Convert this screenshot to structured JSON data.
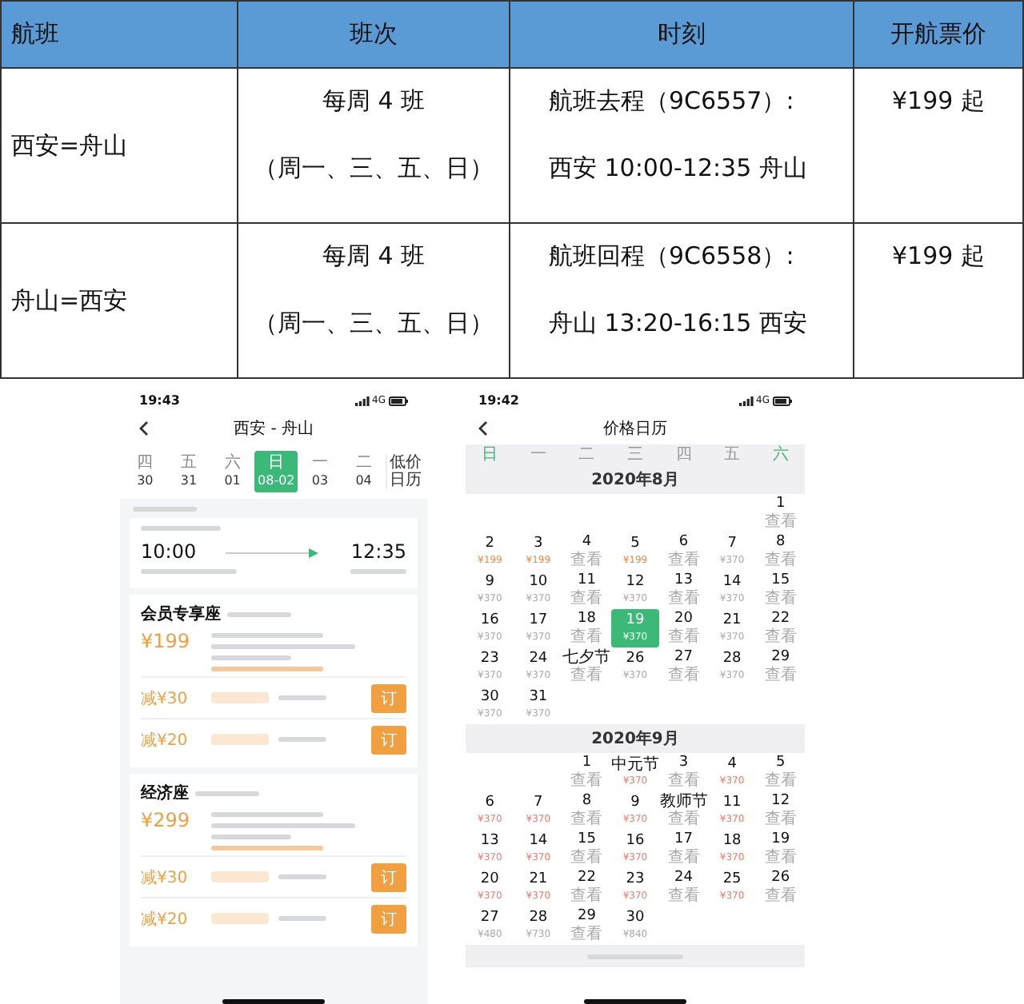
{
  "table": {
    "columns": [
      "航班",
      "班次",
      "时刻",
      "开航票价"
    ],
    "rows": [
      {
        "route": "西安=舟山",
        "frequency": [
          "每周 4 班",
          "（周一、三、五、日）"
        ],
        "schedule": [
          "航班去程（9C6557）:",
          "西安 10:00-12:35 舟山"
        ],
        "price": "¥199 起"
      },
      {
        "route": "舟山=西安",
        "frequency": [
          "每周 4 班",
          "（周一、三、五、日）"
        ],
        "schedule": [
          "航班回程（9C6558）:",
          "舟山 13:20-16:15 西安"
        ],
        "price": "¥199 起"
      }
    ]
  },
  "phone_booking": {
    "status": {
      "time": "19:43",
      "network": "4G"
    },
    "title": "西安 - 舟山",
    "dates": [
      {
        "weekday": "四",
        "date": "30",
        "selected": false
      },
      {
        "weekday": "五",
        "date": "31",
        "selected": false
      },
      {
        "weekday": "六",
        "date": "01",
        "selected": false
      },
      {
        "weekday": "日",
        "date": "08-02",
        "selected": true
      },
      {
        "weekday": "一",
        "date": "03",
        "selected": false
      },
      {
        "weekday": "二",
        "date": "04",
        "selected": false
      }
    ],
    "calendar_button": "低价日历",
    "flight": {
      "depart": "10:00",
      "arrive": "12:35"
    },
    "cabins": [
      {
        "name": "会员专享座",
        "price": "¥199",
        "offers": [
          {
            "discount": "减¥30",
            "button": "订"
          },
          {
            "discount": "减¥20",
            "button": "订"
          }
        ]
      },
      {
        "name": "经济座",
        "price": "¥299",
        "offers": [
          {
            "discount": "减¥30",
            "button": "订"
          },
          {
            "discount": "减¥20",
            "button": "订"
          }
        ]
      }
    ]
  },
  "phone_calendar": {
    "status": {
      "time": "19:42",
      "network": "4G"
    },
    "title": "价格日历",
    "weekdays": [
      {
        "label": "日",
        "color": "#3cb878"
      },
      {
        "label": "一",
        "color": "#999999"
      },
      {
        "label": "二",
        "color": "#999999"
      },
      {
        "label": "三",
        "color": "#999999"
      },
      {
        "label": "四",
        "color": "#999999"
      },
      {
        "label": "五",
        "color": "#999999"
      },
      {
        "label": "六",
        "color": "#3cb878"
      }
    ],
    "months": [
      {
        "title": "2020年8月",
        "cells": [
          {
            "kind": "blank"
          },
          {
            "kind": "blank"
          },
          {
            "kind": "blank"
          },
          {
            "kind": "blank"
          },
          {
            "kind": "blank"
          },
          {
            "kind": "blank"
          },
          {
            "kind": "day",
            "day": "1",
            "sub": "查看",
            "color": "#aaaaaa",
            "selected": false
          },
          {
            "kind": "day",
            "day": "2",
            "sub": "¥199",
            "color": "#f08a3c",
            "selected": false
          },
          {
            "kind": "day",
            "day": "3",
            "sub": "¥199",
            "color": "#f08a3c",
            "selected": false
          },
          {
            "kind": "day",
            "day": "4",
            "sub": "查看",
            "color": "#aaaaaa",
            "selected": false
          },
          {
            "kind": "day",
            "day": "5",
            "sub": "¥199",
            "color": "#f08a3c",
            "selected": false
          },
          {
            "kind": "day",
            "day": "6",
            "sub": "查看",
            "color": "#aaaaaa",
            "selected": false
          },
          {
            "kind": "day",
            "day": "7",
            "sub": "¥370",
            "color": "#aaaaaa",
            "selected": false
          },
          {
            "kind": "day",
            "day": "8",
            "sub": "查看",
            "color": "#aaaaaa",
            "selected": false
          },
          {
            "kind": "day",
            "day": "9",
            "sub": "¥370",
            "color": "#aaaaaa",
            "selected": false
          },
          {
            "kind": "day",
            "day": "10",
            "sub": "¥370",
            "color": "#aaaaaa",
            "selected": false
          },
          {
            "kind": "day",
            "day": "11",
            "sub": "查看",
            "color": "#aaaaaa",
            "selected": false
          },
          {
            "kind": "day",
            "day": "12",
            "sub": "¥370",
            "color": "#aaaaaa",
            "selected": false
          },
          {
            "kind": "day",
            "day": "13",
            "sub": "查看",
            "color": "#aaaaaa",
            "selected": false
          },
          {
            "kind": "day",
            "day": "14",
            "sub": "¥370",
            "color": "#aaaaaa",
            "selected": false
          },
          {
            "kind": "day",
            "day": "15",
            "sub": "查看",
            "color": "#aaaaaa",
            "selected": false
          },
          {
            "kind": "day",
            "day": "16",
            "sub": "¥370",
            "color": "#aaaaaa",
            "selected": false
          },
          {
            "kind": "day",
            "day": "17",
            "sub": "¥370",
            "color": "#aaaaaa",
            "selected": false
          },
          {
            "kind": "day",
            "day": "18",
            "sub": "查看",
            "color": "#aaaaaa",
            "selected": false
          },
          {
            "kind": "day",
            "day": "19",
            "sub": "¥370",
            "color": "#ffffff",
            "selected": true
          },
          {
            "kind": "day",
            "day": "20",
            "sub": "查看",
            "color": "#aaaaaa",
            "selected": false
          },
          {
            "kind": "day",
            "day": "21",
            "sub": "¥370",
            "color": "#aaaaaa",
            "selected": false
          },
          {
            "kind": "day",
            "day": "22",
            "sub": "查看",
            "color": "#aaaaaa",
            "selected": false
          },
          {
            "kind": "day",
            "day": "23",
            "sub": "¥370",
            "color": "#aaaaaa",
            "selected": false
          },
          {
            "kind": "day",
            "day": "24",
            "sub": "¥370",
            "color": "#aaaaaa",
            "selected": false
          },
          {
            "kind": "day",
            "day": "七夕节",
            "sub": "查看",
            "color": "#aaaaaa",
            "selected": false
          },
          {
            "kind": "day",
            "day": "26",
            "sub": "¥370",
            "color": "#aaaaaa",
            "selected": false
          },
          {
            "kind": "day",
            "day": "27",
            "sub": "查看",
            "color": "#aaaaaa",
            "selected": false
          },
          {
            "kind": "day",
            "day": "28",
            "sub": "¥370",
            "color": "#aaaaaa",
            "selected": false
          },
          {
            "kind": "day",
            "day": "29",
            "sub": "查看",
            "color": "#aaaaaa",
            "selected": false
          },
          {
            "kind": "day",
            "day": "30",
            "sub": "¥370",
            "color": "#aaaaaa",
            "selected": false
          },
          {
            "kind": "day",
            "day": "31",
            "sub": "¥370",
            "color": "#aaaaaa",
            "selected": false
          }
        ]
      },
      {
        "title": "2020年9月",
        "cells": [
          {
            "kind": "blank"
          },
          {
            "kind": "blank"
          },
          {
            "kind": "day",
            "day": "1",
            "sub": "查看",
            "color": "#aaaaaa",
            "selected": false
          },
          {
            "kind": "day",
            "day": "中元节",
            "sub": "¥370",
            "color": "#f07a6a",
            "selected": false
          },
          {
            "kind": "day",
            "day": "3",
            "sub": "查看",
            "color": "#aaaaaa",
            "selected": false
          },
          {
            "kind": "day",
            "day": "4",
            "sub": "¥370",
            "color": "#f07a6a",
            "selected": false
          },
          {
            "kind": "day",
            "day": "5",
            "sub": "查看",
            "color": "#aaaaaa",
            "selected": false
          },
          {
            "kind": "day",
            "day": "6",
            "sub": "¥370",
            "color": "#f07a6a",
            "selected": false
          },
          {
            "kind": "day",
            "day": "7",
            "sub": "¥370",
            "color": "#f07a6a",
            "selected": false
          },
          {
            "kind": "day",
            "day": "8",
            "sub": "查看",
            "color": "#aaaaaa",
            "selected": false
          },
          {
            "kind": "day",
            "day": "9",
            "sub": "¥370",
            "color": "#f07a6a",
            "selected": false
          },
          {
            "kind": "day",
            "day": "教师节",
            "sub": "查看",
            "color": "#aaaaaa",
            "selected": false
          },
          {
            "kind": "day",
            "day": "11",
            "sub": "¥370",
            "color": "#f07a6a",
            "selected": false
          },
          {
            "kind": "day",
            "day": "12",
            "sub": "查看",
            "color": "#aaaaaa",
            "selected": false
          },
          {
            "kind": "day",
            "day": "13",
            "sub": "¥370",
            "color": "#f07a6a",
            "selected": false
          },
          {
            "kind": "day",
            "day": "14",
            "sub": "¥370",
            "color": "#f07a6a",
            "selected": false
          },
          {
            "kind": "day",
            "day": "15",
            "sub": "查看",
            "color": "#aaaaaa",
            "selected": false
          },
          {
            "kind": "day",
            "day": "16",
            "sub": "¥370",
            "color": "#f07a6a",
            "selected": false
          },
          {
            "kind": "day",
            "day": "17",
            "sub": "查看",
            "color": "#aaaaaa",
            "selected": false
          },
          {
            "kind": "day",
            "day": "18",
            "sub": "¥370",
            "color": "#f07a6a",
            "selected": false
          },
          {
            "kind": "day",
            "day": "19",
            "sub": "查看",
            "color": "#aaaaaa",
            "selected": false
          },
          {
            "kind": "day",
            "day": "20",
            "sub": "¥370",
            "color": "#f07a6a",
            "selected": false
          },
          {
            "kind": "day",
            "day": "21",
            "sub": "¥370",
            "color": "#f07a6a",
            "selected": false
          },
          {
            "kind": "day",
            "day": "22",
            "sub": "查看",
            "color": "#aaaaaa",
            "selected": false
          },
          {
            "kind": "day",
            "day": "23",
            "sub": "¥370",
            "color": "#f07a6a",
            "selected": false
          },
          {
            "kind": "day",
            "day": "24",
            "sub": "查看",
            "color": "#aaaaaa",
            "selected": false
          },
          {
            "kind": "day",
            "day": "25",
            "sub": "¥370",
            "color": "#f07a6a",
            "selected": false
          },
          {
            "kind": "day",
            "day": "26",
            "sub": "查看",
            "color": "#aaaaaa",
            "selected": false
          },
          {
            "kind": "day",
            "day": "27",
            "sub": "¥480",
            "color": "#aaaaaa",
            "selected": false
          },
          {
            "kind": "day",
            "day": "28",
            "sub": "¥730",
            "color": "#aaaaaa",
            "selected": false
          },
          {
            "kind": "day",
            "day": "29",
            "sub": "查看",
            "color": "#aaaaaa",
            "selected": false
          },
          {
            "kind": "day",
            "day": "30",
            "sub": "¥840",
            "color": "#aaaaaa",
            "selected": false
          }
        ]
      }
    ]
  }
}
